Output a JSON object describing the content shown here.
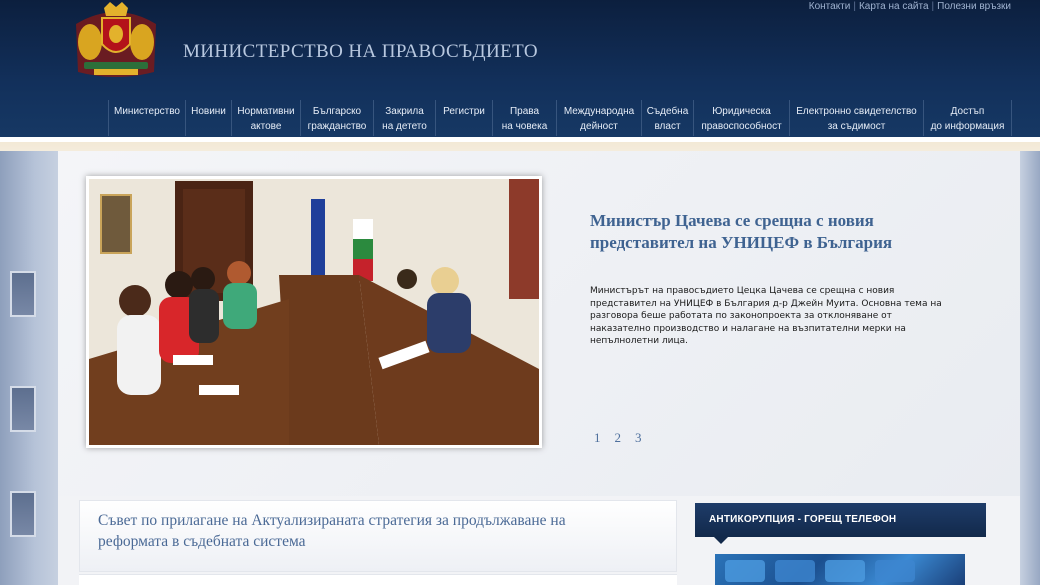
{
  "top_links": [
    "Контакти",
    "Карта на сайта",
    "Полезни връзки"
  ],
  "site": {
    "title": "МИНИСТЕРСТВО НА ПРАВОСЪДИЕТО"
  },
  "nav": [
    {
      "line1": "Министерство",
      "line2": ""
    },
    {
      "line1": "Новини",
      "line2": ""
    },
    {
      "line1": "Нормативни",
      "line2": "актове"
    },
    {
      "line1": "Българско",
      "line2": "гражданство"
    },
    {
      "line1": "Закрила",
      "line2": "на детето"
    },
    {
      "line1": "Регистри",
      "line2": ""
    },
    {
      "line1": "Права",
      "line2": "на човека"
    },
    {
      "line1": "Международна",
      "line2": "дейност"
    },
    {
      "line1": "Съдебна",
      "line2": "власт"
    },
    {
      "line1": "Юридическа",
      "line2": "правоспособност"
    },
    {
      "line1": "Електронно свидетелство",
      "line2": "за съдимост"
    },
    {
      "line1": "Достъп",
      "line2": "до информация"
    }
  ],
  "slider": {
    "title": "Министър Цачева се срещна с новия представител на УНИЦЕФ в България",
    "text": "Министърът на правосъдието Цецка Цачева се срещна с новия представител на УНИЦЕФ в България д-р Джейн Муита. Основна тема на разговора беше работата по законопроекта за отклоняване от наказателно производство и налагане на възпитателни мерки на непълнолетни лица.",
    "pages": [
      "1",
      "2",
      "3"
    ]
  },
  "news": {
    "title": "Съвет по прилагане на Актуализираната стратегия за продължаване на реформата в съдебната система"
  },
  "hotline": {
    "title": "АНТИКОРУПЦИЯ - ГОРЕЩ ТЕЛЕФОН"
  }
}
